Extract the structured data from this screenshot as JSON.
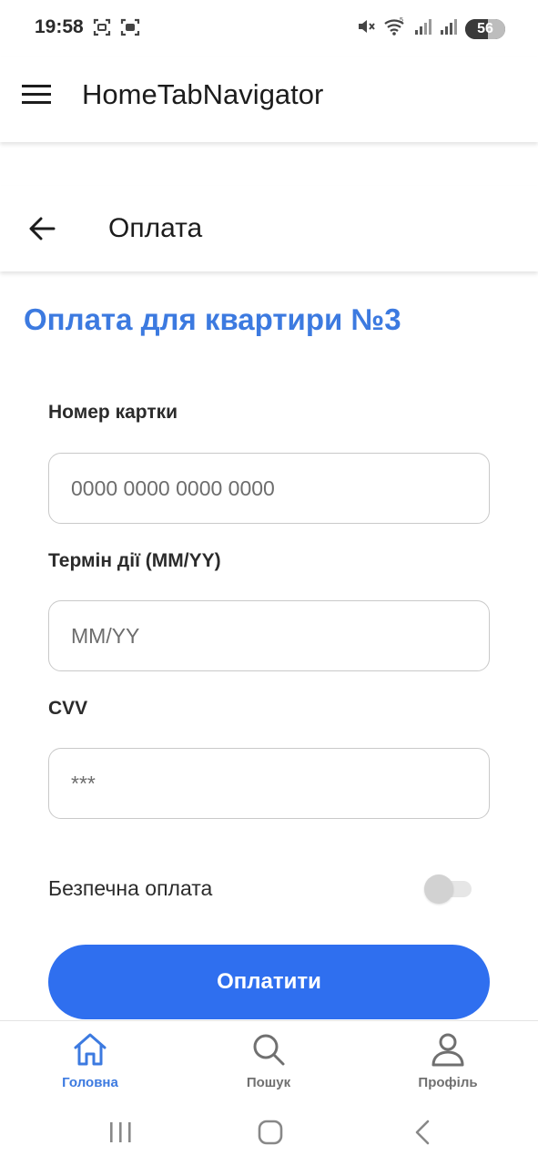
{
  "status_bar": {
    "time": "19:58",
    "battery": "56",
    "icons": [
      "screenshot-icon",
      "face-scan-icon",
      "mute-icon",
      "wifi-icon",
      "signal-icon",
      "signal-icon"
    ]
  },
  "app_header": {
    "title": "HomeTabNavigator",
    "menu_icon": "hamburger-menu-icon"
  },
  "stack_header": {
    "title": "Оплата",
    "back_icon": "arrow-left-icon"
  },
  "content": {
    "heading": "Оплата для квартири №3",
    "card_number": {
      "label": "Номер картки",
      "placeholder": "0000 0000 0000 0000",
      "value": ""
    },
    "expiry": {
      "label": "Термін дії (MM/YY)",
      "placeholder": "MM/YY",
      "value": ""
    },
    "cvv": {
      "label": "CVV",
      "placeholder": "***",
      "value": ""
    },
    "secure_payment": {
      "label": "Безпечна оплата",
      "enabled": false
    },
    "pay_button": "Оплатити"
  },
  "tabs": [
    {
      "label": "Головна",
      "icon": "home-icon",
      "active": true
    },
    {
      "label": "Пошук",
      "icon": "search-icon",
      "active": false
    },
    {
      "label": "Профіль",
      "icon": "profile-icon",
      "active": false
    }
  ],
  "colors": {
    "accent": "#3c7ae0",
    "button": "#2f6fef",
    "text": "#1c1c1c",
    "border": "#c9c9c9"
  }
}
